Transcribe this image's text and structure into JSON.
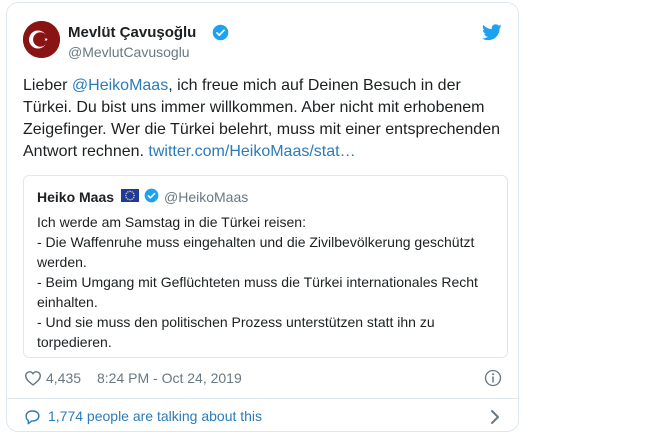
{
  "author": {
    "name": "Mevlüt Çavuşoğlu",
    "handle": "@MevlutCavusoglu"
  },
  "tweet": {
    "text_before_mention": "Lieber ",
    "mention": "@HeikoMaas",
    "text_after_mention": ", ich freue mich auf Deinen Besuch in der Türkei. Du bist uns immer willkommen. Aber nicht mit erhobenem Zeigefinger. Wer die Türkei belehrt, muss mit einer entsprechenden Antwort rechnen. ",
    "link": "twitter.com/HeikoMaas/stat…"
  },
  "quoted": {
    "name": "Heiko Maas",
    "handle": "@HeikoMaas",
    "lines": [
      "Ich werde am Samstag in die Türkei reisen:",
      "- Die Waffenruhe muss eingehalten und die Zivilbevölkerung geschützt werden.",
      "- Beim Umgang mit Geflüchteten muss die Türkei internationales Recht einhalten.",
      "- Und sie muss den politischen Prozess unterstützen statt ihn zu torpedieren."
    ]
  },
  "footer": {
    "likes": "4,435",
    "timestamp": "8:24 PM - Oct 24, 2019",
    "talking": "1,774 people are talking about this"
  },
  "colors": {
    "link": "#2b7bb9",
    "verified": "#1da1f2",
    "secondary_text": "#697882",
    "border": "#e1e8ed"
  },
  "icons": [
    "turkish-flag-avatar",
    "verified-badge-icon",
    "twitter-bird-icon",
    "eu-flag-icon",
    "heart-icon",
    "info-icon",
    "speech-bubble-icon",
    "chevron-right-icon"
  ]
}
